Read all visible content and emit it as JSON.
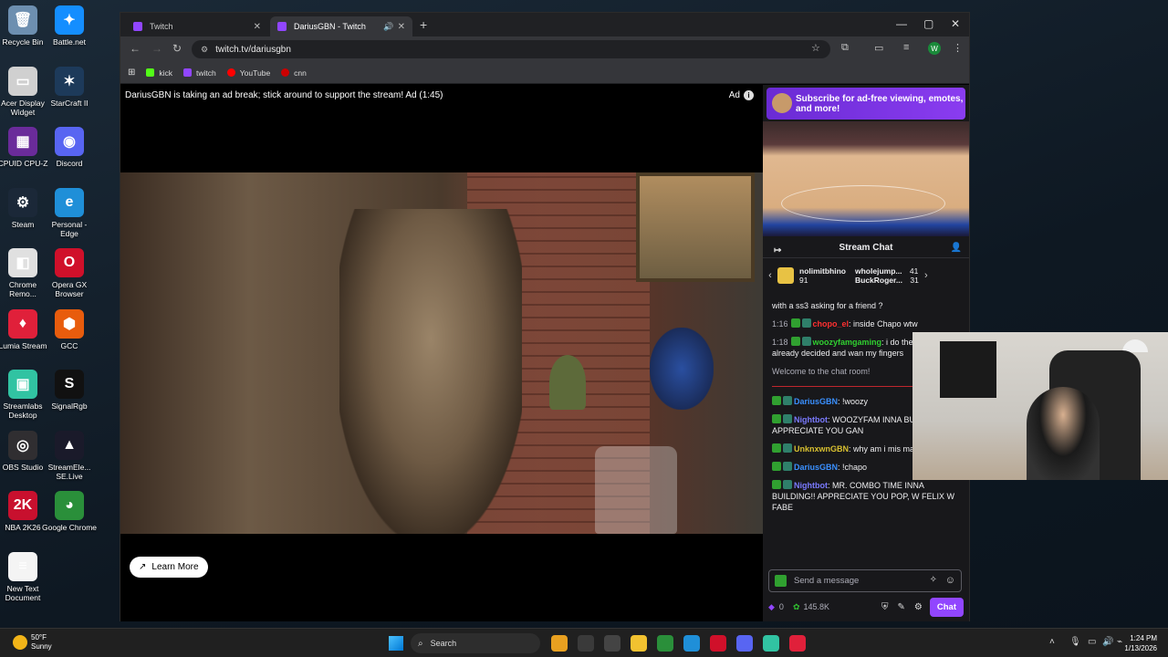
{
  "desktop_icons": [
    {
      "label": "Recycle Bin",
      "color": "#6d8fb0",
      "glyph": "🗑"
    },
    {
      "label": "Battle.net",
      "color": "#148eff",
      "glyph": "✦"
    },
    {
      "label": "Acer Display Widget",
      "color": "#d0d0d0",
      "glyph": "▭"
    },
    {
      "label": "StarCraft II",
      "color": "#1d3a5a",
      "glyph": "✶"
    },
    {
      "label": "CPUID CPU-Z",
      "color": "#6a2b9a",
      "glyph": "▦"
    },
    {
      "label": "Discord",
      "color": "#5865f2",
      "glyph": "◉"
    },
    {
      "label": "Steam",
      "color": "#1b2838",
      "glyph": "⚙"
    },
    {
      "label": "Personal - Edge",
      "color": "#1f8fd8",
      "glyph": "e"
    },
    {
      "label": "Chrome Remo...",
      "color": "#e0e0e0",
      "glyph": "◧"
    },
    {
      "label": "Opera GX Browser",
      "color": "#d0102a",
      "glyph": "O"
    },
    {
      "label": "Lumia Stream",
      "color": "#e0203a",
      "glyph": "♦"
    },
    {
      "label": "GCC",
      "color": "#e85c0d",
      "glyph": "⬢"
    },
    {
      "label": "Streamlabs Desktop",
      "color": "#31c3a2",
      "glyph": "▣"
    },
    {
      "label": "SignalRgb",
      "color": "#111111",
      "glyph": "S"
    },
    {
      "label": "OBS Studio",
      "color": "#302e31",
      "glyph": "◎"
    },
    {
      "label": "StreamEle... SE.Live",
      "color": "#1a1a2a",
      "glyph": "▲"
    },
    {
      "label": "NBA 2K26",
      "color": "#c8102e",
      "glyph": "2K"
    },
    {
      "label": "Google Chrome",
      "color": "#2a8f3a",
      "glyph": "◕"
    },
    {
      "label": "New Text Document",
      "color": "#f4f4f4",
      "glyph": "≡"
    }
  ],
  "browser": {
    "tabs": [
      {
        "label": "Twitch",
        "active": false
      },
      {
        "label": "DariusGBN - Twitch",
        "active": true
      }
    ],
    "new_tab": "+",
    "url": "twitch.tv/dariusgbn",
    "profile_initial": "W",
    "bookmarks": [
      {
        "label": "kick",
        "color": "#53fc18"
      },
      {
        "label": "twitch",
        "color": "#9146ff"
      },
      {
        "label": "YouTube",
        "color": "#ff0000"
      },
      {
        "label": "cnn",
        "color": "#cc0000"
      }
    ]
  },
  "player": {
    "ad_banner": "DariusGBN is taking an ad break; stick around to support the stream! Ad (1:45)",
    "ad_tag": "Ad",
    "learn_more": "Learn More"
  },
  "sidebar": {
    "promo": "Subscribe for ad-free viewing, emotes, and more!",
    "chat_title": "Stream Chat",
    "gifters": [
      {
        "name": "nolimitbhino",
        "count": "91"
      },
      {
        "name": "wholejump...",
        "count": "41"
      },
      {
        "name": "BuckRoger...",
        "count": "31"
      }
    ],
    "messages": [
      {
        "time": "",
        "user": "",
        "user_color": "#efeff1",
        "text": "with a ss3 asking for a friend ?"
      },
      {
        "time": "1:16",
        "user": "chopo_el",
        "user_color": "#ff3030",
        "text": ": inside Chapo wtw"
      },
      {
        "time": "1:18",
        "user": "woozyfamgaming",
        "user_color": "#30d030",
        "text": ": i do the game already decided and wan my fingers"
      }
    ],
    "welcome": "Welcome to the chat room!",
    "messages2": [
      {
        "user": "DariusGBN",
        "user_color": "#3a90ff",
        "text": ": !woozy"
      },
      {
        "user": "Nightbot",
        "user_color": "#7a7aff",
        "text": ": WOOZYFAM INNA BUILDING!! APPRECIATE YOU GAN"
      },
      {
        "user": "UnknxwnGBN",
        "user_color": "#d8c030",
        "text": ": why am i mis man"
      },
      {
        "user": "DariusGBN",
        "user_color": "#3a90ff",
        "text": ": !chapo"
      },
      {
        "user": "Nightbot",
        "user_color": "#7a7aff",
        "text": ": MR. COMBO TIME INNA BUILDING!! APPRECIATE YOU POP, W FELIX W FABE"
      }
    ],
    "input_placeholder": "Send a message",
    "points_zero": "0",
    "points": "145.8K",
    "chat_button": "Chat"
  },
  "taskbar": {
    "weather_temp": "50°F",
    "weather_desc": "Sunny",
    "search": "Search",
    "time": "1:24 PM",
    "date": "1/13/2026",
    "app_colors": [
      "#e8a020",
      "#3a3a3a",
      "#444444",
      "#f2c230",
      "#2a8f3a",
      "#1f8fd8",
      "#d0102a",
      "#5865f2",
      "#31c3a2",
      "#e0203a"
    ]
  }
}
